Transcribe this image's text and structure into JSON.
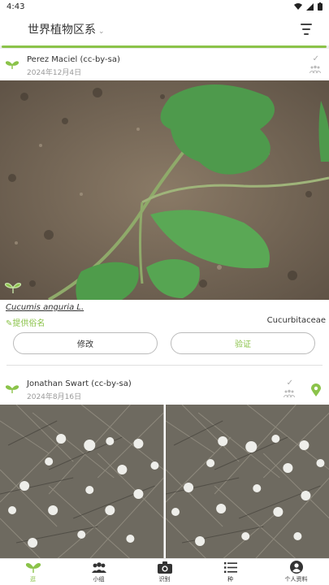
{
  "status_bar": {
    "time": "4:43"
  },
  "app_bar": {
    "title": "世界植物区系",
    "caret": "⌄"
  },
  "colors": {
    "accent": "#8bc34a",
    "text": "#333333",
    "muted": "#999999"
  },
  "observations": [
    {
      "user": "Perez Maciel (cc-by-sa)",
      "date": "2024年12月4日",
      "check": "✓",
      "species": "Cucumis anguria L.",
      "suggest_name": "提供俗名",
      "family": "Cucurbitaceae",
      "edit_label": "修改",
      "verify_label": "验证"
    },
    {
      "user": "Jonathan Swart (cc-by-sa)",
      "date": "2024年8月16日",
      "check": "✓"
    }
  ],
  "nav": [
    {
      "label": "逛",
      "icon": "sprout-icon",
      "active": true
    },
    {
      "label": "小组",
      "icon": "group-icon",
      "active": false
    },
    {
      "label": "识别",
      "icon": "camera-icon",
      "active": false
    },
    {
      "label": "种",
      "icon": "list-icon",
      "active": false
    },
    {
      "label": "个人资料",
      "icon": "profile-icon",
      "active": false
    }
  ]
}
